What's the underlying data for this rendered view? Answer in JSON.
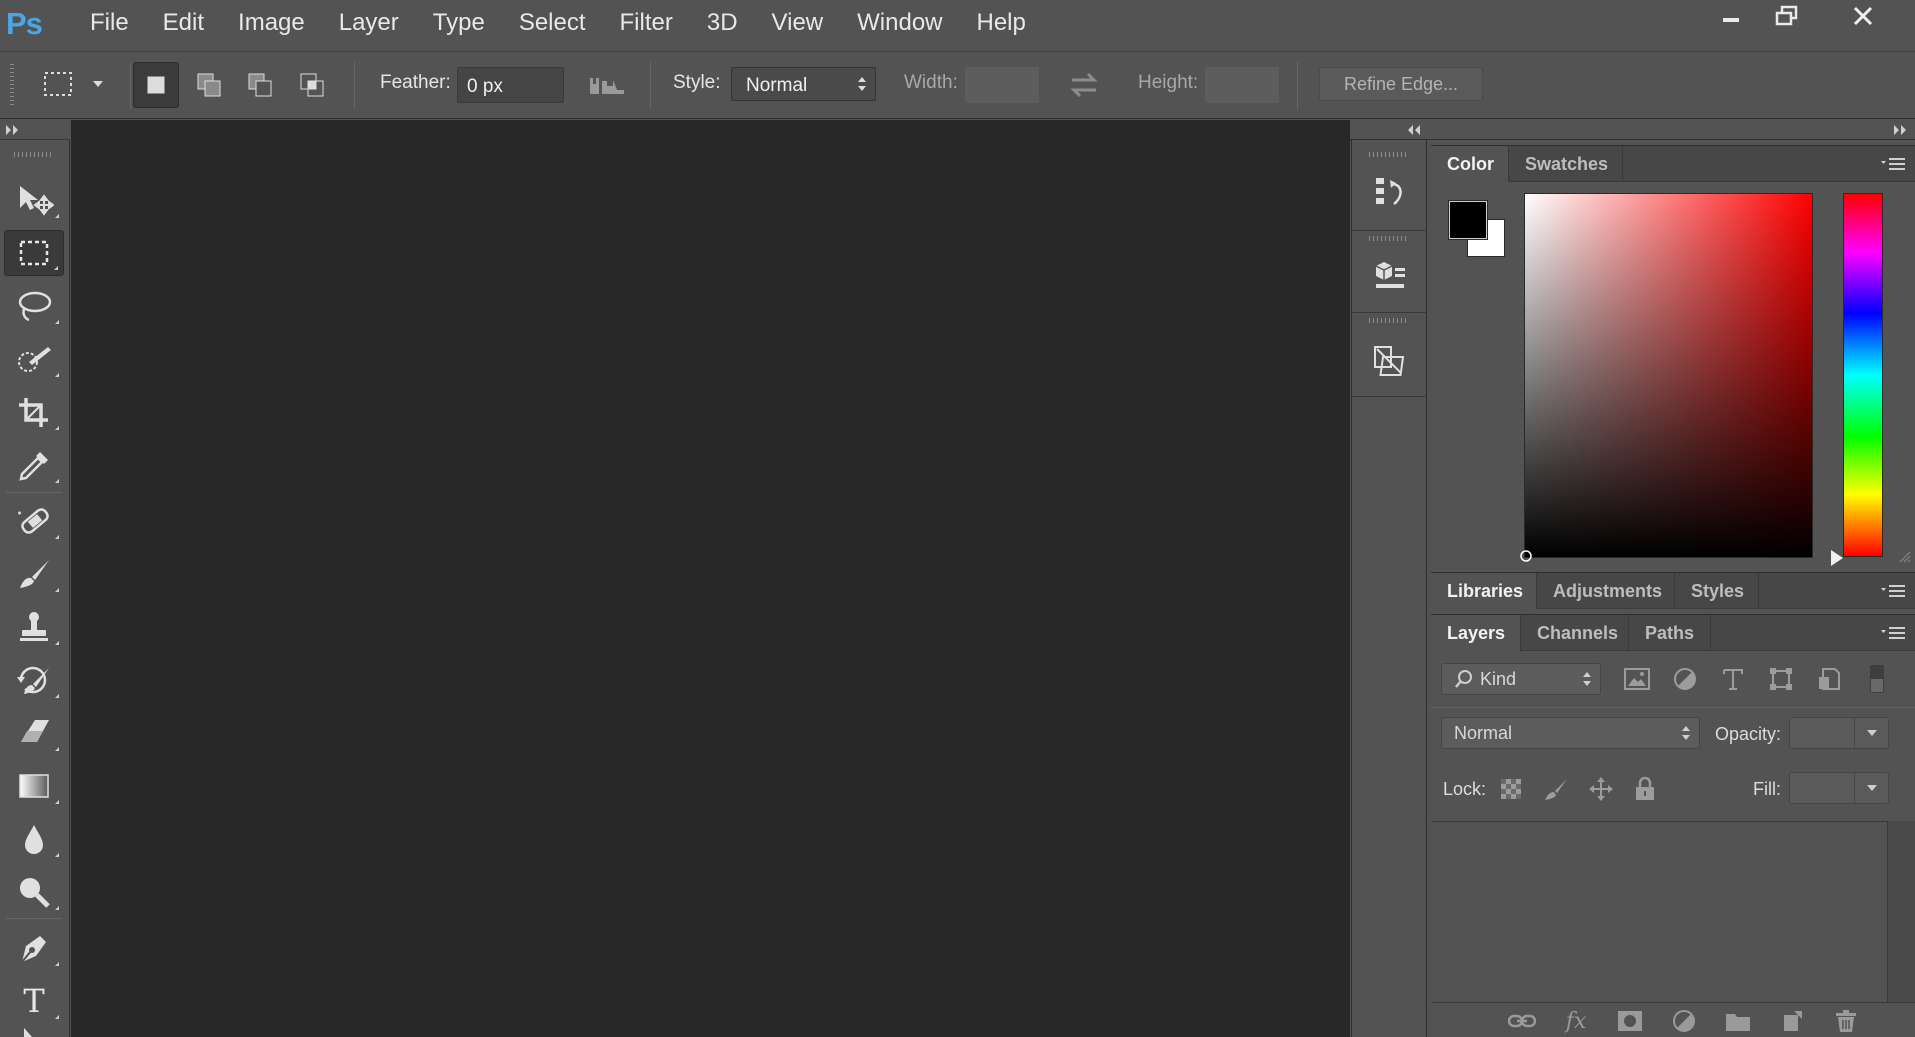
{
  "app": {
    "logo": "Ps",
    "menu": [
      "File",
      "Edit",
      "Image",
      "Layer",
      "Type",
      "Select",
      "Filter",
      "3D",
      "View",
      "Window",
      "Help"
    ]
  },
  "window_controls": [
    "minimize-icon",
    "restore-icon",
    "close-icon"
  ],
  "options_bar": {
    "feather_label": "Feather:",
    "feather_value": "0 px",
    "style_label": "Style:",
    "style_value": "Normal",
    "width_label": "Width:",
    "width_value": "",
    "height_label": "Height:",
    "height_value": "",
    "refine_edge_label": "Refine Edge..."
  },
  "tools": [
    "move-tool-icon",
    "rectangular-marquee-tool-icon",
    "lasso-tool-icon",
    "quick-selection-tool-icon",
    "crop-tool-icon",
    "eyedropper-tool-icon",
    "spot-healing-brush-icon",
    "brush-tool-icon",
    "clone-stamp-tool-icon",
    "history-brush-icon",
    "eraser-tool-icon",
    "gradient-tool-icon",
    "blur-tool-icon",
    "dodge-tool-icon",
    "pen-tool-icon",
    "type-tool-icon"
  ],
  "type_tool_glyph": "T",
  "color_panel": {
    "tabs": [
      "Color",
      "Swatches"
    ],
    "foreground": "#000000",
    "background": "#ffffff",
    "hue": "#ff0000"
  },
  "libraries_panel": {
    "tabs": [
      "Libraries",
      "Adjustments",
      "Styles"
    ]
  },
  "layers_panel": {
    "tabs": [
      "Layers",
      "Channels",
      "Paths"
    ],
    "filter_value": "Kind",
    "blend_mode": "Normal",
    "opacity_label": "Opacity:",
    "opacity_value": "",
    "lock_label": "Lock:",
    "fill_label": "Fill:",
    "fill_value": "",
    "footer_fx": "fx"
  }
}
